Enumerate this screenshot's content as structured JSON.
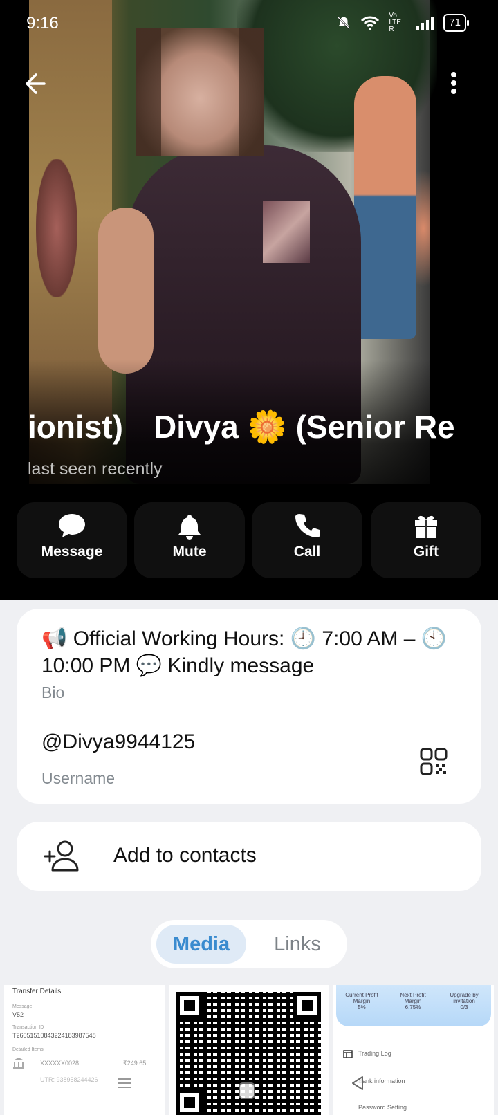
{
  "status_bar": {
    "time": "9:16",
    "battery": "71",
    "network": "Vo LTE R"
  },
  "profile": {
    "name": "Divya 🌼 (Senior Receptionist)",
    "name_visible_prefix": "ionist)",
    "name_visible_main": "Divya 🌼 (Senior Re",
    "last_seen": "last seen recently"
  },
  "actions": [
    {
      "label": "Message",
      "icon": "message-icon"
    },
    {
      "label": "Mute",
      "icon": "bell-icon"
    },
    {
      "label": "Call",
      "icon": "phone-icon"
    },
    {
      "label": "Gift",
      "icon": "gift-icon"
    }
  ],
  "info": {
    "bio": "📢 Official Working Hours: 🕘 7:00 AM – 🕙 10:00 PM 💬 Kindly message",
    "bio_label": "Bio",
    "username": "@Divya9944125",
    "username_label": "Username"
  },
  "contacts": {
    "label": "Add to contacts"
  },
  "tabs": [
    {
      "label": "Media",
      "active": true
    },
    {
      "label": "Links",
      "active": false
    }
  ],
  "media": {
    "thumb1": {
      "title": "Transfer Details",
      "message_label": "Message",
      "message_value": "V52",
      "txn_label": "Transaction ID",
      "txn_value": "T2605151084322418398754​8",
      "detailed_label": "Detailed Items",
      "account": "XXXXXX0028",
      "amount": "₹249.65",
      "utr": "UTR: 938958244426"
    },
    "thumb3": {
      "col1": "Current Profit Margin",
      "col1_val": "5%",
      "col2": "Next Profit Margin",
      "col2_val": "6.75%",
      "col3": "Upgrade by invitation",
      "col3_val": "0/3",
      "item1": "Trading Log",
      "item2": "Bank information",
      "item3": "Password Setting"
    }
  },
  "colors": {
    "accent": "#3a8bcf",
    "tab_active_bg": "#dfeaf6",
    "page_bg": "#eff0f3",
    "secondary_text": "#838a90"
  }
}
